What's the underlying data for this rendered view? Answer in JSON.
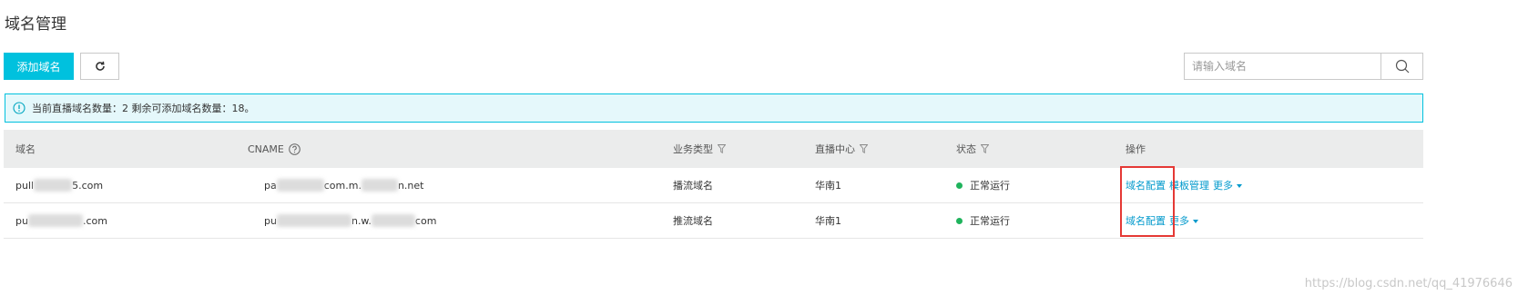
{
  "header": {
    "title": "域名管理"
  },
  "toolbar": {
    "add_label": "添加域名"
  },
  "search": {
    "placeholder": "请输入域名"
  },
  "notice": {
    "text": "当前直播域名数量：2 剩余可添加域名数量：18。"
  },
  "table": {
    "columns": {
      "domain": "域名",
      "cname": "CNAME",
      "type": "业务类型",
      "center": "直播中心",
      "status": "状态",
      "ops": "操作"
    },
    "rows": [
      {
        "domain_a": "pull",
        "domain_b": "5.com",
        "cname_a": "pa",
        "cname_b": "com.m.",
        "cname_c": "n.net",
        "type": "播流域名",
        "center": "华南1",
        "status": "正常运行",
        "op1": "域名配置",
        "op2": "模板管理",
        "op3": "更多"
      },
      {
        "domain_a": "pu",
        "domain_b": ".com",
        "cname_a": "pu",
        "cname_b": "n.w.",
        "cname_c": "com",
        "type": "推流域名",
        "center": "华南1",
        "status": "正常运行",
        "op1": "域名配置",
        "op2": "",
        "op3": "更多"
      }
    ]
  },
  "watermark": "https://blog.csdn.net/qq_41976646",
  "colors": {
    "primary": "#00c1de",
    "link": "#0099cc",
    "status_ok": "#1fb35c",
    "highlight": "#e53935"
  }
}
